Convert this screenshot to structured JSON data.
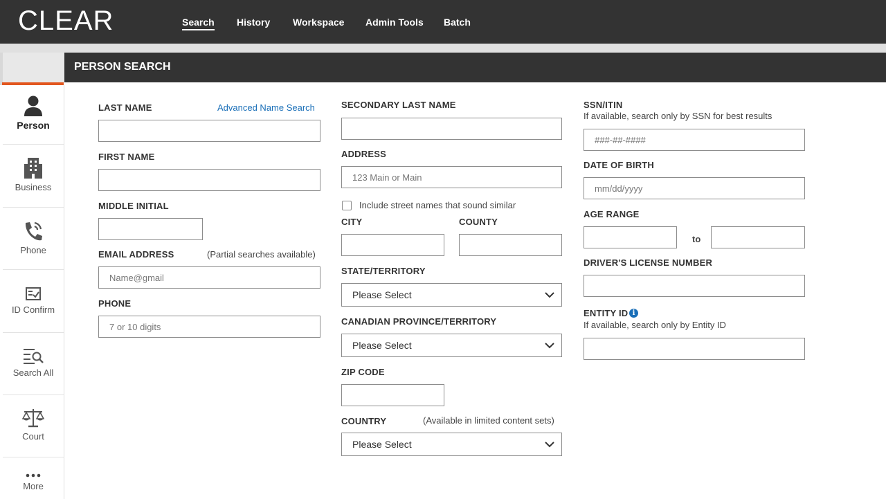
{
  "app": {
    "logo": "CLEAR"
  },
  "nav": {
    "search": "Search",
    "history": "History",
    "workspace": "Workspace",
    "admin_tools": "Admin Tools",
    "batch": "Batch"
  },
  "sidebar": {
    "items": [
      {
        "label": "Person",
        "icon": "person-icon",
        "active": true
      },
      {
        "label": "Business",
        "icon": "building-icon"
      },
      {
        "label": "Phone",
        "icon": "phone-icon"
      },
      {
        "label": "ID Confirm",
        "icon": "id-confirm-icon"
      },
      {
        "label": "Search All",
        "icon": "search-all-icon"
      },
      {
        "label": "Court",
        "icon": "scales-icon"
      },
      {
        "label": "More",
        "icon": "more-icon"
      }
    ]
  },
  "page": {
    "title": "PERSON SEARCH"
  },
  "form": {
    "last_name": {
      "label": "LAST NAME",
      "value": ""
    },
    "advanced_link": "Advanced Name Search",
    "first_name": {
      "label": "FIRST NAME",
      "value": ""
    },
    "middle_initial": {
      "label": "MIDDLE INITIAL",
      "value": ""
    },
    "email": {
      "label": "EMAIL ADDRESS",
      "hint": "(Partial searches available)",
      "placeholder": "Name@gmail",
      "value": ""
    },
    "phone": {
      "label": "PHONE",
      "placeholder": "7 or 10 digits",
      "value": ""
    },
    "secondary_last_name": {
      "label": "SECONDARY LAST NAME",
      "value": ""
    },
    "address": {
      "label": "ADDRESS",
      "placeholder": "123 Main or Main",
      "value": ""
    },
    "sound_similar": {
      "label": "Include street names that sound similar",
      "checked": false
    },
    "city": {
      "label": "CITY",
      "value": ""
    },
    "county": {
      "label": "COUNTY",
      "value": ""
    },
    "state": {
      "label": "STATE/TERRITORY",
      "selected": "Please Select"
    },
    "province": {
      "label": "CANADIAN PROVINCE/TERRITORY",
      "selected": "Please Select"
    },
    "zip": {
      "label": "ZIP CODE",
      "value": ""
    },
    "country": {
      "label": "COUNTRY",
      "hint": "(Available in limited content sets)",
      "selected": "Please Select"
    },
    "ssn": {
      "label": "SSN/ITIN",
      "hint": "If available, search only by SSN for best results",
      "placeholder": "###-##-####",
      "value": ""
    },
    "dob": {
      "label": "DATE OF BIRTH",
      "placeholder": "mm/dd/yyyy",
      "value": ""
    },
    "age_range": {
      "label": "AGE RANGE",
      "to": "to",
      "from_value": "",
      "to_value": ""
    },
    "drivers_license": {
      "label": "DRIVER'S LICENSE NUMBER",
      "value": ""
    },
    "entity_id": {
      "label": "ENTITY ID",
      "hint": "If available, search only by Entity ID",
      "info_icon": "i",
      "value": ""
    }
  },
  "colors": {
    "topbar": "#333333",
    "accent": "#e2561e",
    "link": "#1a6fb8"
  }
}
